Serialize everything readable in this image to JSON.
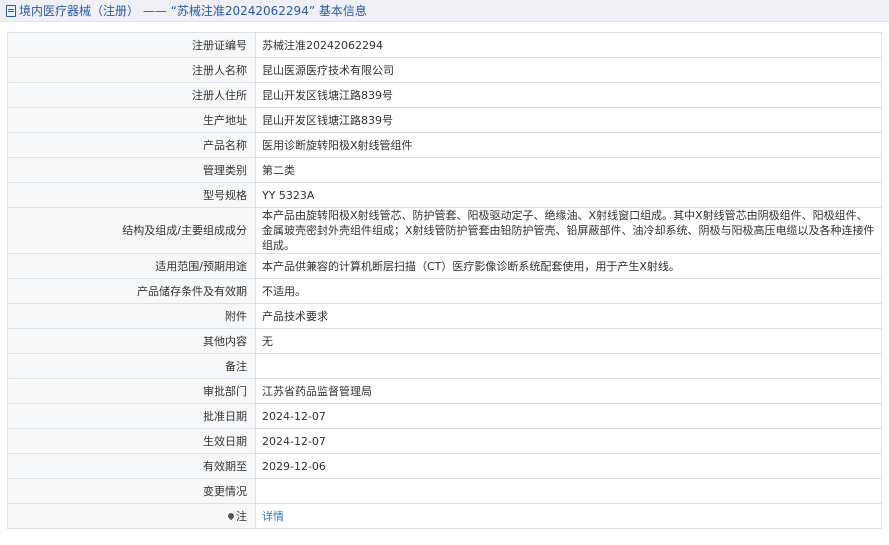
{
  "header": {
    "title": "境内医疗器械（注册） —— “苏械注准20242062294” 基本信息"
  },
  "rows": [
    {
      "label": "注册证编号",
      "value": "苏械注准20242062294"
    },
    {
      "label": "注册人名称",
      "value": "昆山医源医疗技术有限公司"
    },
    {
      "label": "注册人住所",
      "value": "昆山开发区钱塘江路839号"
    },
    {
      "label": "生产地址",
      "value": "昆山开发区钱塘江路839号"
    },
    {
      "label": "产品名称",
      "value": "医用诊断旋转阳极X射线管组件"
    },
    {
      "label": "管理类别",
      "value": "第二类"
    },
    {
      "label": "型号规格",
      "value": "YY 5323A"
    },
    {
      "label": "结构及组成/主要组成成分",
      "value": "本产品由旋转阳极X射线管芯、防护管套、阳极驱动定子、绝缘油、X射线窗口组成。其中X射线管芯由阴极组件、阳极组件、金属玻壳密封外壳组件组成；X射线管防护管套由铅防护管壳、铅屏蔽部件、油冷却系统、阴极与阳极高压电缆以及各种连接件组成。"
    },
    {
      "label": "适用范围/预期用途",
      "value": "本产品供兼容的计算机断层扫描（CT）医疗影像诊断系统配套使用，用于产生X射线。"
    },
    {
      "label": "产品储存条件及有效期",
      "value": "不适用。"
    },
    {
      "label": "附件",
      "value": "产品技术要求"
    },
    {
      "label": "其他内容",
      "value": "无"
    },
    {
      "label": "备注",
      "value": ""
    },
    {
      "label": "审批部门",
      "value": "江苏省药品监督管理局"
    },
    {
      "label": "批准日期",
      "value": "2024-12-07"
    },
    {
      "label": "生效日期",
      "value": "2024-12-07"
    },
    {
      "label": "有效期至",
      "value": "2029-12-06"
    },
    {
      "label": "变更情况",
      "value": ""
    },
    {
      "label": "注",
      "value": "详情"
    }
  ],
  "icons": {
    "header_icon": "document-icon",
    "note_icon": "pin-icon"
  },
  "colors": {
    "header_text": "#2b5aa0",
    "link": "#2f79c8"
  }
}
